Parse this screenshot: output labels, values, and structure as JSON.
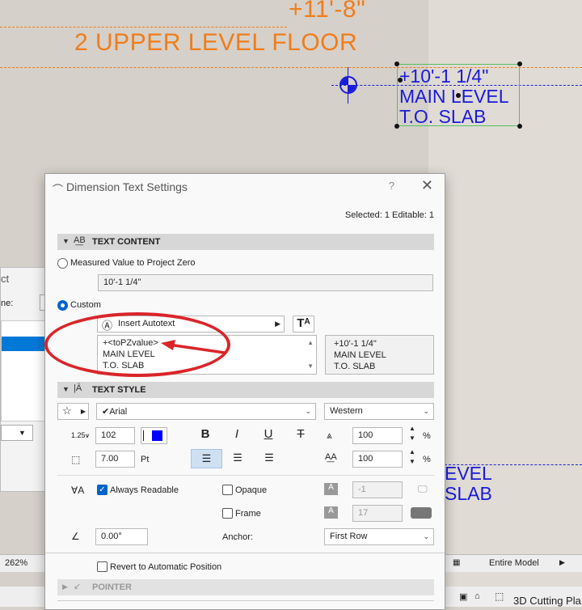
{
  "canvas": {
    "story_elevation": "+11'-8\"",
    "story_name": "2 UPPER LEVEL FLOOR",
    "marker_elevation": "+10'-1 1/4\"",
    "marker_line1": "MAIN LEVEL",
    "marker_line2": "T.O. SLAB",
    "partial_line1": "EVEL",
    "partial_line2": "SLAB",
    "colors": {
      "story": "#f07d1a",
      "level": "#1a1ad8",
      "selection": "#55c060",
      "annotation": "#d9252a"
    }
  },
  "background_dialog": {
    "fragment1": "ct",
    "fragment2": "ne:"
  },
  "status_bar": {
    "zoom": "262%",
    "model_view": "Entire Model"
  },
  "bottom_bar": {
    "cutting_plane": "3D Cutting Pla"
  },
  "dialog": {
    "title": "Dimension Text Settings",
    "help": "?",
    "close": "✕",
    "selection_info": "Selected: 1 Editable: 1",
    "text_content": {
      "header": "TEXT CONTENT",
      "measured_label": "Measured Value to Project Zero",
      "measured_value": "10'-1 1/4\"",
      "custom_label": "Custom",
      "insert_autotext": "Insert Autotext",
      "text_lines": [
        "+<toPZvalue>",
        "MAIN LEVEL",
        "T.O. SLAB"
      ],
      "preview_lines": [
        "+10'-1 1/4\"",
        "MAIN LEVEL",
        "T.O. SLAB"
      ]
    },
    "text_style": {
      "header": "TEXT STYLE",
      "font": "Arial",
      "script": "Western",
      "pen": "102",
      "pen_color": "#0000ff",
      "size": "7.00",
      "size_unit": "Pt",
      "width_pct": "100",
      "spacing_pct": "100",
      "pct": "%",
      "always_readable": "Always Readable",
      "opaque": "Opaque",
      "frame": "Frame",
      "opaque_pen": "-1",
      "frame_pen": "17",
      "angle": "0.00°",
      "anchor_label": "Anchor:",
      "anchor_value": "First Row",
      "revert": "Revert to Automatic Position"
    },
    "pointer": {
      "header": "POINTER"
    }
  }
}
